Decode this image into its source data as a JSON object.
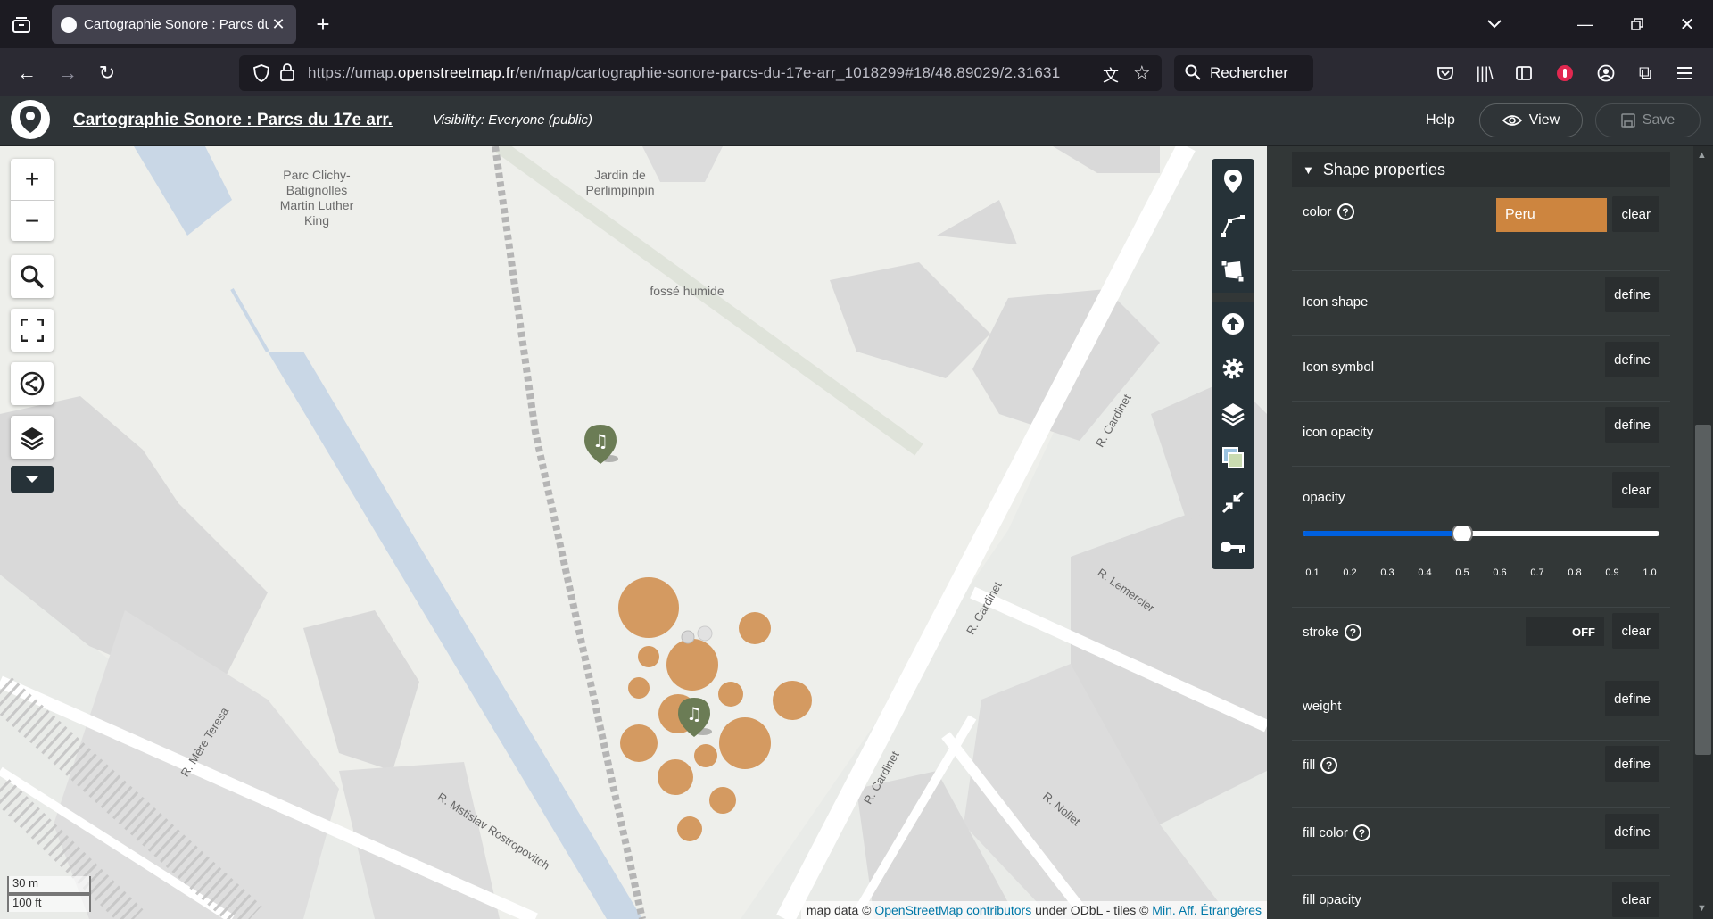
{
  "browser": {
    "tab_title": "Cartographie Sonore : Parcs du",
    "url_prefix": "https://umap.",
    "url_domain": "openstreetmap.fr",
    "url_path": "/en/map/cartographie-sonore-parcs-du-17e-arr_1018299#18/48.89029/2.31631",
    "search_placeholder": "Rechercher"
  },
  "header": {
    "map_title": "Cartographie Sonore : Parcs du 17e arr.",
    "visibility": "Visibility: Everyone (public)",
    "help_label": "Help",
    "view_label": "View",
    "save_label": "Save"
  },
  "map": {
    "labels": {
      "park_clichy": "Parc Clichy-\nBatignolles\nMartin Luther\nKing",
      "jardin": "Jardin de\nPerlimpinpin",
      "fosse": "fossé humide"
    },
    "streets": {
      "cardinet_1": "R. Cardinet",
      "cardinet_2": "R. Cardinet",
      "cardinet_3": "R. Cardinet",
      "lemercier": "R. Lemercier",
      "nollet": "R. Nollet",
      "mere_teresa": "R. Mère Teresa",
      "rostropovitch": "R. Mstislav Rostropovitch"
    },
    "scale": {
      "metric": "30 m",
      "imperial": "100 ft"
    },
    "attribution": {
      "prefix": "map data © ",
      "osm": "OpenStreetMap contributors",
      "middle": " under ODbL - tiles © ",
      "tiles": "Min. Aff. Étrangères"
    },
    "circle_color": "#cd853f",
    "marker_color": "#6b7c55"
  },
  "panel": {
    "section_title": "Shape properties",
    "color_label": "color",
    "color_value": "Peru",
    "clear_label": "clear",
    "define_label": "define",
    "icon_shape": "Icon shape",
    "icon_symbol": "Icon symbol",
    "icon_opacity": "icon opacity",
    "opacity": "opacity",
    "opacity_value": 0.5,
    "ticks": [
      "0.1",
      "0.2",
      "0.3",
      "0.4",
      "0.5",
      "0.6",
      "0.7",
      "0.8",
      "0.9",
      "1.0"
    ],
    "stroke": "stroke",
    "stroke_state": "OFF",
    "weight": "weight",
    "fill": "fill",
    "fill_color": "fill color",
    "fill_opacity": "fill opacity"
  }
}
